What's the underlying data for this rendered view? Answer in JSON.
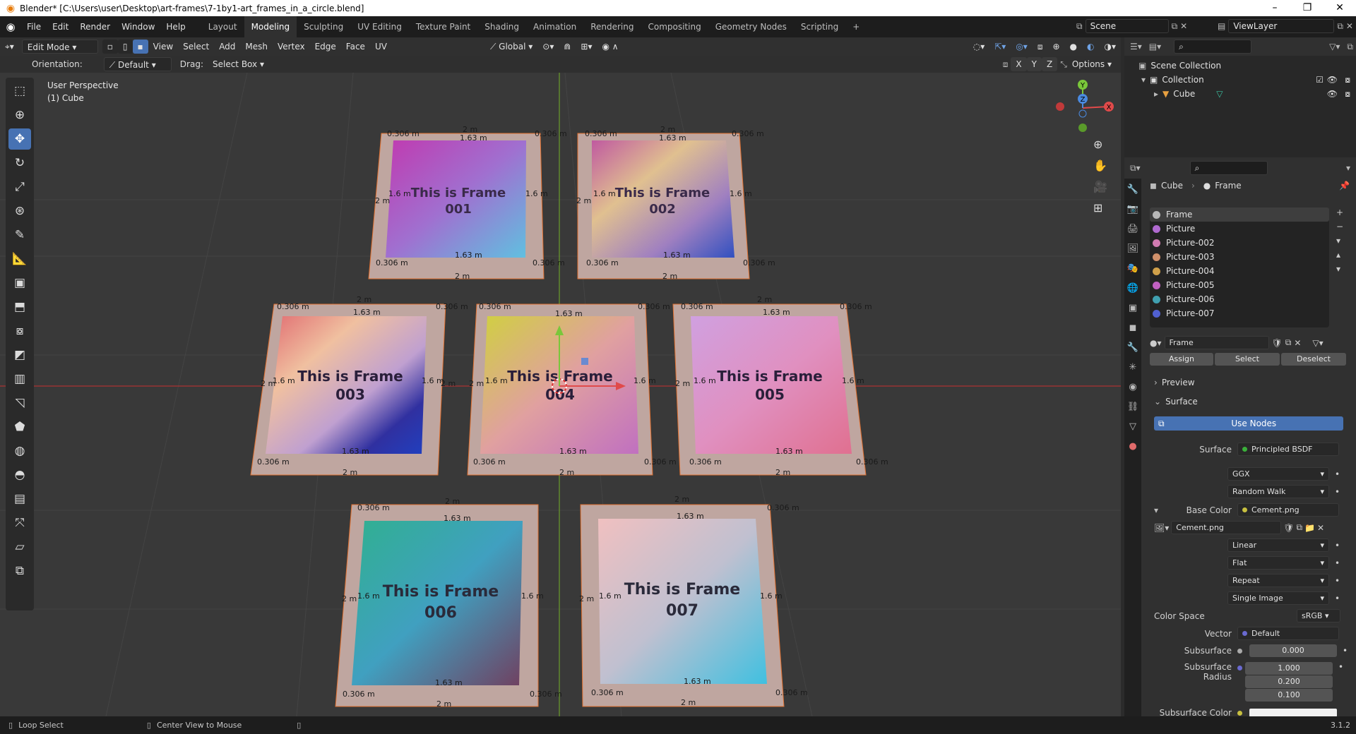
{
  "window": {
    "title": "Blender* [C:\\Users\\user\\Desktop\\art-frames\\7-1by1-art_frames_in_a_circle.blend]",
    "min": "–",
    "max": "❐",
    "close": "✕"
  },
  "menu": [
    "File",
    "Edit",
    "Render",
    "Window",
    "Help"
  ],
  "workspaces": [
    "Layout",
    "Modeling",
    "Sculpting",
    "UV Editing",
    "Texture Paint",
    "Shading",
    "Animation",
    "Rendering",
    "Compositing",
    "Geometry Nodes",
    "Scripting",
    "+"
  ],
  "active_workspace": "Modeling",
  "scene": {
    "label": "Scene",
    "viewlayer": "ViewLayer"
  },
  "header3d": {
    "mode": "Edit Mode",
    "items": [
      "View",
      "Select",
      "Add",
      "Mesh",
      "Vertex",
      "Edge",
      "Face",
      "UV"
    ],
    "transform": "Global"
  },
  "toolsettings": {
    "orientation_label": "Orientation:",
    "orientation": "Default",
    "drag_label": "Drag:",
    "drag": "Select Box",
    "options": "Options",
    "axes": [
      "X",
      "Y",
      "Z"
    ]
  },
  "viewport": {
    "perspective": "User Perspective",
    "object": "(1) Cube",
    "gizmo_axes": [
      "Y",
      "Z",
      "X"
    ]
  },
  "frames": [
    {
      "line1": "This is Frame",
      "line2": "001"
    },
    {
      "line1": "This is Frame",
      "line2": "002"
    },
    {
      "line1": "This is Frame",
      "line2": "003"
    },
    {
      "line1": "This is Frame",
      "line2": "004"
    },
    {
      "line1": "This is Frame",
      "line2": "005"
    },
    {
      "line1": "This is Frame",
      "line2": "006"
    },
    {
      "line1": "This is Frame",
      "line2": "007"
    }
  ],
  "dims": {
    "outer": "2 m",
    "inner": "1.63 m",
    "side": "1.6 m",
    "corner": "0.306 m"
  },
  "outliner": {
    "root": "Scene Collection",
    "collection": "Collection",
    "object": "Cube"
  },
  "properties": {
    "breadcrumb_obj": "Cube",
    "breadcrumb_mat": "Frame",
    "slots": [
      {
        "name": "Frame",
        "color": "#b8b8b8"
      },
      {
        "name": "Picture",
        "color": "#b06ad0"
      },
      {
        "name": "Picture-002",
        "color": "#d07ab0"
      },
      {
        "name": "Picture-003",
        "color": "#d0906a"
      },
      {
        "name": "Picture-004",
        "color": "#d0a04a"
      },
      {
        "name": "Picture-005",
        "color": "#c060c0"
      },
      {
        "name": "Picture-006",
        "color": "#40a0b0"
      },
      {
        "name": "Picture-007",
        "color": "#5060d0"
      }
    ],
    "material_name": "Frame",
    "assign": "Assign",
    "select": "Select",
    "deselect": "Deselect",
    "preview": "Preview",
    "surface_panel": "Surface",
    "use_nodes": "Use Nodes",
    "surface_label": "Surface",
    "surface_value": "Principled BSDF",
    "distribution": "GGX",
    "subsurface_method": "Random Walk",
    "base_color_label": "Base Color",
    "base_color_value": "Cement.png",
    "image": "Cement.png",
    "interp": "Linear",
    "projection": "Flat",
    "extension": "Repeat",
    "source": "Single Image",
    "colorspace_label": "Color Space",
    "colorspace": "sRGB",
    "vector_label": "Vector",
    "vector": "Default",
    "subsurface_label": "Subsurface",
    "subsurface": "0.000",
    "radius_label": "Subsurface Radius",
    "radius": [
      "1.000",
      "0.200",
      "0.100"
    ],
    "subcolor_label": "Subsurface Color"
  },
  "status": {
    "left": "Loop Select",
    "mid": "Center View to Mouse",
    "version": "3.1.2"
  }
}
